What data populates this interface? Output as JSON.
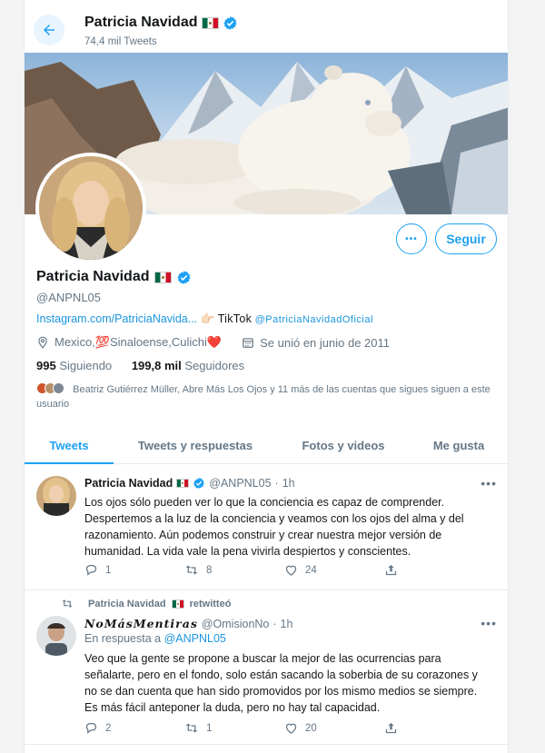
{
  "header": {
    "name": "Patricia Navidad",
    "tweet_count": "74,4 mil Tweets"
  },
  "profile": {
    "name": "Patricia Navidad",
    "handle": "@ANPNL05",
    "bio_link": "Instagram.com/PatriciaNavida...",
    "bio_tiktok_label": "TikTok",
    "bio_tiktok_handle": "@PatriciaNavidadOficial",
    "location": "Mexico,💯Sinaloense,Culichi❤️",
    "joined": "Se unió en junio de 2011",
    "following_count": "995",
    "following_label": "Siguiendo",
    "followers_count": "199,8 mil",
    "followers_label": "Seguidores",
    "followed_by": "Beatriz Gutiérrez Müller, Abre Más Los Ojos y 11 más de las cuentas que sigues siguen a este usuario",
    "follow_button": "Seguir",
    "more_button": "•••"
  },
  "tabs": [
    {
      "label": "Tweets",
      "active": true
    },
    {
      "label": "Tweets y respuestas",
      "active": false
    },
    {
      "label": "Fotos y videos",
      "active": false
    },
    {
      "label": "Me gusta",
      "active": false
    }
  ],
  "tweets": [
    {
      "name": "Patricia Navidad",
      "handle": "@ANPNL05",
      "dot": "·",
      "time": "1h",
      "text": "Los ojos sólo pueden ver lo que la conciencia es capaz de comprender. Despertemos a la luz de la conciencia y veamos con los ojos del alma y del razonamiento. Aún podemos construir y crear nuestra mejor versión de humanidad. La vida vale la pena vivirla despiertos y conscientes.",
      "replies": "1",
      "retweets": "8",
      "likes": "24",
      "more": "•••"
    },
    {
      "retweeted_by": "Patricia Navidad",
      "retweeted_label": "retwitteó",
      "name": "𝑵𝒐𝑴á𝒔𝑴𝒆𝒏𝒕𝒊𝒓𝒂𝒔",
      "handle": "@OmisionNo",
      "dot": "·",
      "time": "1h",
      "reply_prefix": "En respuesta a",
      "reply_to": "@ANPNL05",
      "text": "Veo que la gente se propone a buscar la mejor de las ocurrencias para señalarte, pero en el fondo, solo están sacando la soberbia de su corazones y no se dan cuenta que han sido promovidos por los mismo medios se siempre. Es más fácil anteponer la duda, pero no hay tal capacidad.",
      "replies": "2",
      "retweets": "1",
      "likes": "20",
      "more": "•••"
    }
  ],
  "colors": {
    "accent": "#1da1f2",
    "link": "#1b95e0",
    "secondary_text": "#657786"
  }
}
